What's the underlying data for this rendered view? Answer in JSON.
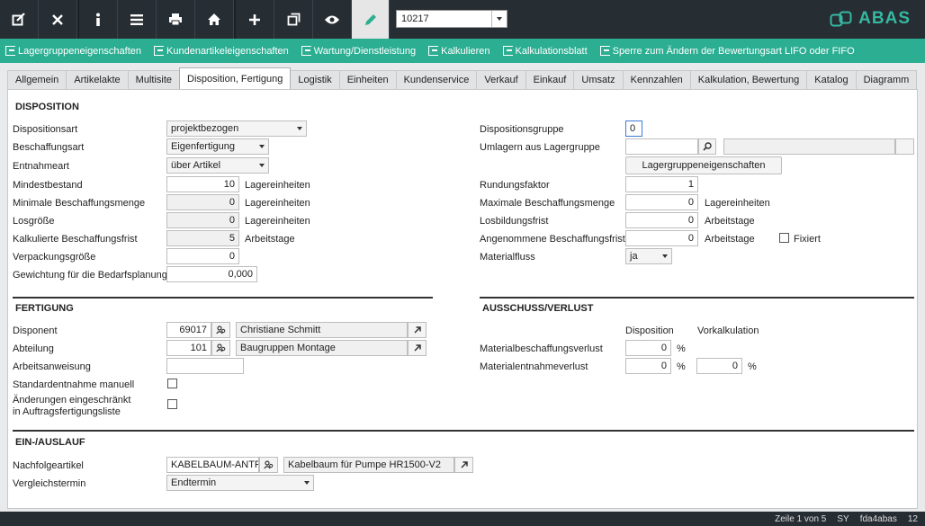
{
  "toolbar": {
    "record_value": "10217",
    "logo_text": "ABAS",
    "buttons": [
      "edit-icon",
      "close-icon",
      "info-icon",
      "menu-icon",
      "print-icon",
      "home-icon",
      "add-icon",
      "copy-icon",
      "view-icon",
      "pencil-icon"
    ]
  },
  "actions": [
    "Lagergruppeneigenschaften",
    "Kundenartikeleigenschaften",
    "Wartung/Dienstleistung",
    "Kalkulieren",
    "Kalkulationsblatt",
    "Sperre zum Ändern der Bewertungsart LIFO oder FIFO"
  ],
  "tabs": [
    "Allgemein",
    "Artikelakte",
    "Multisite",
    "Disposition, Fertigung",
    "Logistik",
    "Einheiten",
    "Kundenservice",
    "Verkauf",
    "Einkauf",
    "Umsatz",
    "Kennzahlen",
    "Kalkulation, Bewertung",
    "Katalog",
    "Diagramm"
  ],
  "active_tab": "Disposition, Fertigung",
  "disposition": {
    "title": "DISPOSITION",
    "dispositionsart_label": "Dispositionsart",
    "dispositionsart_value": "projektbezogen",
    "beschaffungsart_label": "Beschaffungsart",
    "beschaffungsart_value": "Eigenfertigung",
    "entnahmeart_label": "Entnahmeart",
    "entnahmeart_value": "über Artikel",
    "mindestbestand_label": "Mindestbestand",
    "mindestbestand_value": "10",
    "minimale_label": "Minimale Beschaffungsmenge",
    "minimale_value": "0",
    "losgroesse_label": "Losgröße",
    "losgroesse_value": "0",
    "kalk_frist_label": "Kalkulierte Beschaffungsfrist",
    "kalk_frist_value": "5",
    "verpackung_label": "Verpackungsgröße",
    "verpackung_value": "0",
    "gewichtung_label": "Gewichtung für die Bedarfsplanung",
    "gewichtung_value": "0,000",
    "unit_lager": "Lagereinheiten",
    "unit_arbeitstage": "Arbeitstage",
    "dispogruppe_label": "Dispositionsgruppe",
    "dispogruppe_value": "0",
    "umlagern_label": "Umlagern aus Lagergruppe",
    "umlagern_value": "",
    "umlagern_desc": "",
    "lagergruppe_button": "Lagergruppeneigenschaften",
    "rundung_label": "Rundungsfaktor",
    "rundung_value": "1",
    "maximale_label": "Maximale Beschaffungsmenge",
    "maximale_value": "0",
    "losbildung_label": "Losbildungsfrist",
    "losbildung_value": "0",
    "angenommene_label": "Angenommene Beschaffungsfrist",
    "angenommene_value": "0",
    "fixiert_label": "Fixiert",
    "fixiert_checked": false,
    "materialfluss_label": "Materialfluss",
    "materialfluss_value": "ja"
  },
  "fertigung": {
    "title": "FERTIGUNG",
    "disponent_label": "Disponent",
    "disponent_id": "69017",
    "disponent_name": "Christiane Schmitt",
    "abteilung_label": "Abteilung",
    "abteilung_id": "101",
    "abteilung_name": "Baugruppen Montage",
    "arbeitsanweisung_label": "Arbeitsanweisung",
    "arbeitsanweisung_value": "",
    "standard_label": "Standardentnahme manuell",
    "aenderungen_label_1": "Änderungen eingeschränkt",
    "aenderungen_label_2": "in Auftragsfertigungsliste"
  },
  "ausschuss": {
    "title": "AUSSCHUSS/VERLUST",
    "col_disposition": "Disposition",
    "col_vorkalkulation": "Vorkalkulation",
    "materialbeschaffung_label": "Materialbeschaffungsverlust",
    "materialbeschaffung_value": "0",
    "materialentnahme_label": "Materialentnahmeverlust",
    "materialentnahme_disp": "0",
    "materialentnahme_vork": "0",
    "percent": "%"
  },
  "einauslauf": {
    "title": "EIN-/AUSLAUF",
    "nachfolge_label": "Nachfolgeartikel",
    "nachfolge_value": "KABELBAUM-ANTRIE",
    "nachfolge_desc": "Kabelbaum für Pumpe HR1500-V2",
    "vergleich_label": "Vergleichstermin",
    "vergleich_value": "Endtermin"
  },
  "status": {
    "page": "Zeile 1 von 5",
    "lang": "SY",
    "user": "fda4abas",
    "num": "12"
  },
  "colors": {
    "toolbar_bg": "#262d33",
    "accent": "#2bae92",
    "logo": "#35b8a0"
  }
}
